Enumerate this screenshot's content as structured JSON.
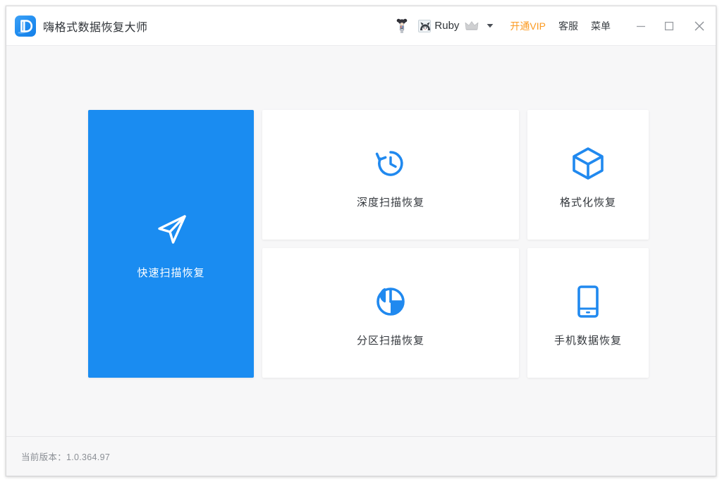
{
  "window": {
    "title": "嗨格式数据恢复大师",
    "logo_icon": "brand-d-logo-icon"
  },
  "titlebar": {
    "mascot_icon": "mascot-figure-icon",
    "account": {
      "avatar_icon": "user-avatar",
      "name": "Ruby",
      "crown_icon": "crown-icon",
      "caret_icon": "chevron-down-icon"
    },
    "vip_label": "开通VIP",
    "support_label": "客服",
    "menu_label": "菜单",
    "controls": {
      "minimize_icon": "minimize-icon",
      "maximize_icon": "maximize-icon",
      "close_icon": "close-icon"
    }
  },
  "tiles": [
    {
      "id": "quick-scan",
      "label": "快速扫描恢复",
      "icon": "navigation-arrow-icon",
      "selected": true
    },
    {
      "id": "deep-scan",
      "label": "深度扫描恢复",
      "icon": "clock-rewind-icon",
      "selected": false
    },
    {
      "id": "format-recovery",
      "label": "格式化恢复",
      "icon": "cube-box-icon",
      "selected": false
    },
    {
      "id": "partition-scan",
      "label": "分区扫描恢复",
      "icon": "pie-chart-icon",
      "selected": false
    },
    {
      "id": "phone-recovery",
      "label": "手机数据恢复",
      "icon": "mobile-phone-icon",
      "selected": false
    }
  ],
  "footer": {
    "version_text": "当前版本：1.0.364.97"
  },
  "colors": {
    "accent_blue": "#1a8cf1",
    "vip_orange": "#fb9a21",
    "content_bg": "#f7f7f8",
    "tile_white": "#ffffff",
    "title_text": "#2f3338",
    "muted_text": "#8b8f95"
  }
}
